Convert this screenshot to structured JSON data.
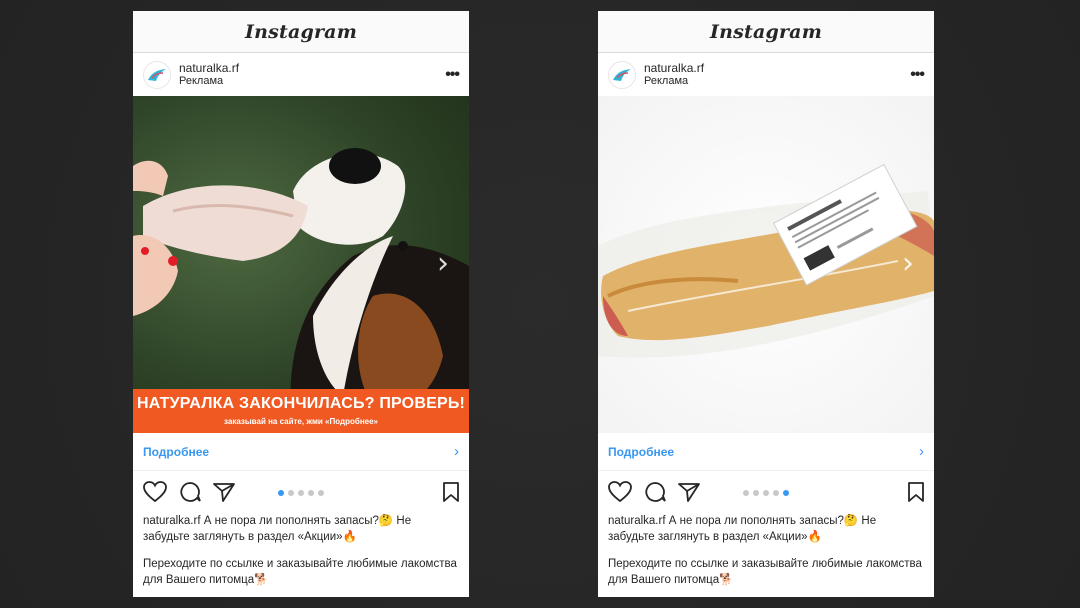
{
  "posts": [
    {
      "app_title": "Instagram",
      "account": "naturalka.rf",
      "sponsored": "Реклама",
      "banner_title": "НАТУРАЛКА ЗАКОНЧИЛАСЬ? ПРОВЕРЬ!",
      "banner_sub": "заказывай на сайте, жми «Подробнее»",
      "more_label": "Подробнее",
      "caption_user": "naturalka.rf",
      "caption_text": "А не пора ли пополнять запасы?🤔 Не забудьте заглянуть в раздел «Акции»🔥",
      "caption_text2": "Переходите по ссылке и заказывайте любимые лакомства для Вашего питомца🐕",
      "pager_count": 5,
      "pager_active": 0
    },
    {
      "app_title": "Instagram",
      "account": "naturalka.rf",
      "sponsored": "Реклама",
      "more_label": "Подробнее",
      "caption_user": "naturalka.rf",
      "caption_text": "А не пора ли пополнять запасы?🤔 Не забудьте заглянуть в раздел «Акции»🔥",
      "caption_text2": "Переходите по ссылке и заказывайте любимые лакомства для Вашего питомца🐕",
      "pager_count": 5,
      "pager_active": 4
    }
  ],
  "colors": {
    "accent": "#3897f0",
    "banner": "#f05a22",
    "background": "#262626"
  },
  "icons": [
    "heart-icon",
    "comment-icon",
    "share-icon",
    "bookmark-icon",
    "more-icon",
    "chevron-right-icon",
    "logo-icon"
  ]
}
